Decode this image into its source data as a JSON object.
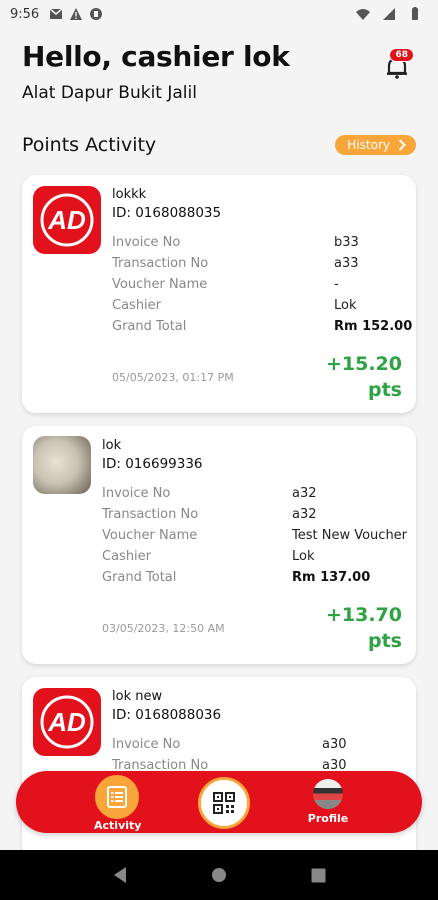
{
  "status": {
    "time": "9:56"
  },
  "header": {
    "greeting": "Hello, cashier lok",
    "store": "Alat Dapur Bukit Jalil",
    "notification_count": "68"
  },
  "section": {
    "title": "Points Activity",
    "history_label": "History"
  },
  "labels": {
    "invoice": "Invoice No",
    "transaction": "Transaction No",
    "voucher": "Voucher Name",
    "cashier": "Cashier",
    "total": "Grand Total"
  },
  "cards": [
    {
      "name": "lokkk",
      "id": "ID: 0168088035",
      "invoice": "b33",
      "transaction": "a33",
      "voucher": "-",
      "cashier": "Lok",
      "total": "Rm 152.00",
      "date": "05/05/2023, 01:17 PM",
      "points": "+15.20",
      "pts_unit": "pts"
    },
    {
      "name": "lok",
      "id": "ID: 016699336",
      "invoice": "a32",
      "transaction": "a32",
      "voucher": "Test New Voucher",
      "cashier": "Lok",
      "total": "Rm 137.00",
      "date": "03/05/2023, 12:50 AM",
      "points": "+13.70",
      "pts_unit": "pts"
    },
    {
      "name": "lok new",
      "id": "ID: 0168088036",
      "invoice": "a30",
      "transaction": "a30"
    }
  ],
  "logo_text": "AD",
  "nav": {
    "activity": "Activity",
    "profile": "Profile"
  },
  "colors": {
    "brand_red": "#e3111b",
    "accent_orange": "#f8a63a",
    "points_green": "#2ea344"
  }
}
